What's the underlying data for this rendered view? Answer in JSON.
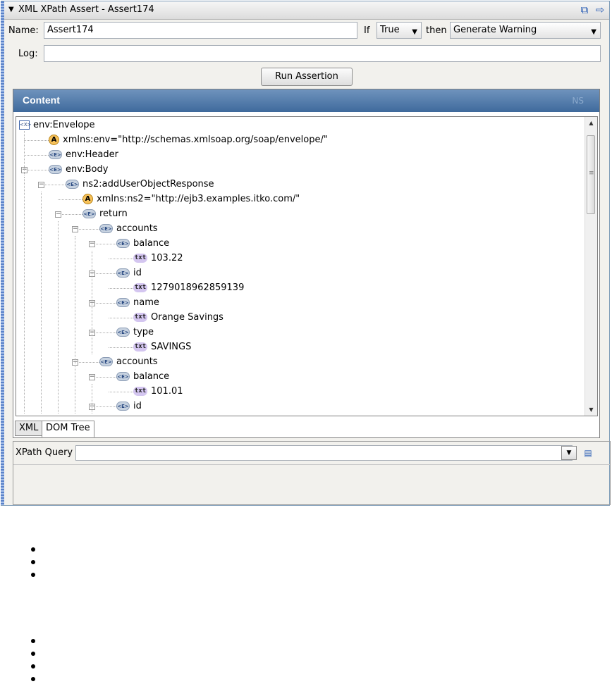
{
  "panel": {
    "title": "XML XPath Assert - Assert174",
    "collapse_glyph": "▼",
    "undock_icon": "undock-icon",
    "forward_icon": "arrow-right-icon"
  },
  "form": {
    "name_label": "Name:",
    "name_value": "Assert174",
    "if_label": "If",
    "if_value": "True",
    "then_label": "then",
    "action_value": "Generate Warning",
    "log_label": "Log:",
    "log_value": "",
    "run_button": "Run Assertion"
  },
  "content": {
    "header": "Content",
    "ghost_text": "NS",
    "tree": [
      {
        "type": "doc",
        "label": "env:Envelope"
      },
      {
        "type": "attr",
        "label": "xmlns:env=\"http://schemas.xmlsoap.org/soap/envelope/\""
      },
      {
        "type": "elem",
        "label": "env:Header"
      },
      {
        "type": "elem",
        "label": "env:Body"
      },
      {
        "type": "elem",
        "label": "ns2:addUserObjectResponse"
      },
      {
        "type": "attr",
        "label": "xmlns:ns2=\"http://ejb3.examples.itko.com/\""
      },
      {
        "type": "elem",
        "label": "return"
      },
      {
        "type": "elem",
        "label": "accounts"
      },
      {
        "type": "elem",
        "label": "balance"
      },
      {
        "type": "text",
        "label": "103.22"
      },
      {
        "type": "elem",
        "label": "id"
      },
      {
        "type": "text",
        "label": "1279018962859139"
      },
      {
        "type": "elem",
        "label": "name"
      },
      {
        "type": "text",
        "label": "Orange Savings"
      },
      {
        "type": "elem",
        "label": "type"
      },
      {
        "type": "text",
        "label": "SAVINGS"
      },
      {
        "type": "elem",
        "label": "accounts"
      },
      {
        "type": "elem",
        "label": "balance"
      },
      {
        "type": "text",
        "label": "101.01"
      },
      {
        "type": "elem",
        "label": "id"
      }
    ],
    "icons": {
      "elem": "<E>",
      "attr": "A",
      "text": "txt",
      "doc": "<X>"
    },
    "tabs": [
      "XML",
      "DOM Tree"
    ],
    "active_tab": "DOM Tree"
  },
  "xpath": {
    "label": "XPath Query",
    "value": ""
  },
  "bullets_group1": 3,
  "bullets_group2": 4
}
